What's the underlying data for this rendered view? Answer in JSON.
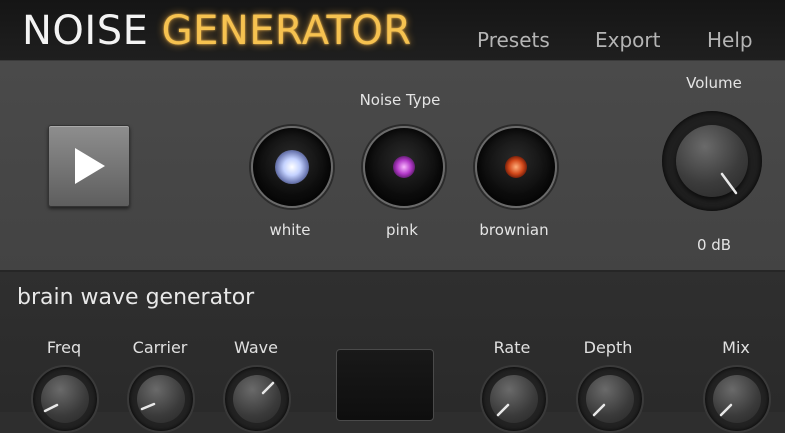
{
  "header": {
    "title_part1": "NOISE",
    "title_part2": "GENERATOR",
    "menu": [
      "Presets",
      "Export",
      "Help"
    ]
  },
  "player": {
    "play_icon": "play-icon"
  },
  "noise_type": {
    "label": "Noise Type",
    "options": [
      {
        "label": "white",
        "color": "#c4d2ff"
      },
      {
        "label": "pink",
        "color": "#b43ac9"
      },
      {
        "label": "brownian",
        "color": "#d2481a"
      }
    ]
  },
  "volume": {
    "label": "Volume",
    "value": "0 dB"
  },
  "brain": {
    "title": "brain wave generator",
    "knobs": [
      "Freq",
      "Carrier",
      "Wave",
      "Rate",
      "Depth",
      "Mix"
    ]
  },
  "colors": {
    "accent": "#f6c250",
    "background": "#2e2e2e",
    "panel": "#474747"
  }
}
